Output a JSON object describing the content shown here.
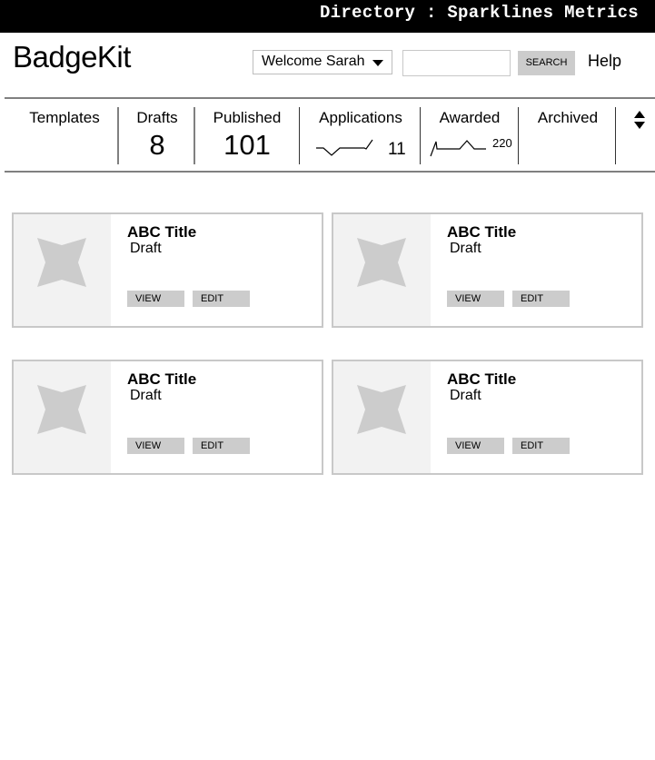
{
  "topbar": {
    "title": "Directory : Sparklines Metrics"
  },
  "header": {
    "brand": "BadgeKit",
    "user_menu": {
      "label": "Welcome Sarah",
      "icon": "caret-down-icon"
    },
    "search": {
      "value": "",
      "placeholder": "",
      "button_label": "SEARCH"
    },
    "help_label": "Help"
  },
  "stats": {
    "templates": {
      "label": "Templates"
    },
    "drafts": {
      "label": "Drafts",
      "value": "8"
    },
    "published": {
      "label": "Published",
      "value": "101"
    },
    "applications": {
      "label": "Applications",
      "value": "11",
      "sparkline_icon": "sparkline-icon"
    },
    "awarded": {
      "label": "Awarded",
      "value": "220",
      "sparkline_icon": "sparkline-icon"
    },
    "archived": {
      "label": "Archived"
    },
    "sort_icon": "sort-up-down-icon"
  },
  "cards": [
    {
      "title": "ABC Title",
      "status": "Draft",
      "view_label": "VIEW",
      "edit_label": "EDIT",
      "icon": "badge-star-icon"
    },
    {
      "title": "ABC Title",
      "status": "Draft",
      "view_label": "VIEW",
      "edit_label": "EDIT",
      "icon": "badge-star-icon"
    },
    {
      "title": "ABC Title",
      "status": "Draft",
      "view_label": "VIEW",
      "edit_label": "EDIT",
      "icon": "badge-star-icon"
    },
    {
      "title": "ABC Title",
      "status": "Draft",
      "view_label": "VIEW",
      "edit_label": "EDIT",
      "icon": "badge-star-icon"
    }
  ],
  "colors": {
    "topbar_bg": "#000000",
    "button_bg": "#cccccc",
    "thumb_bg": "#f2f2f2",
    "star_fill": "#cccccc",
    "rule": "#808080"
  }
}
